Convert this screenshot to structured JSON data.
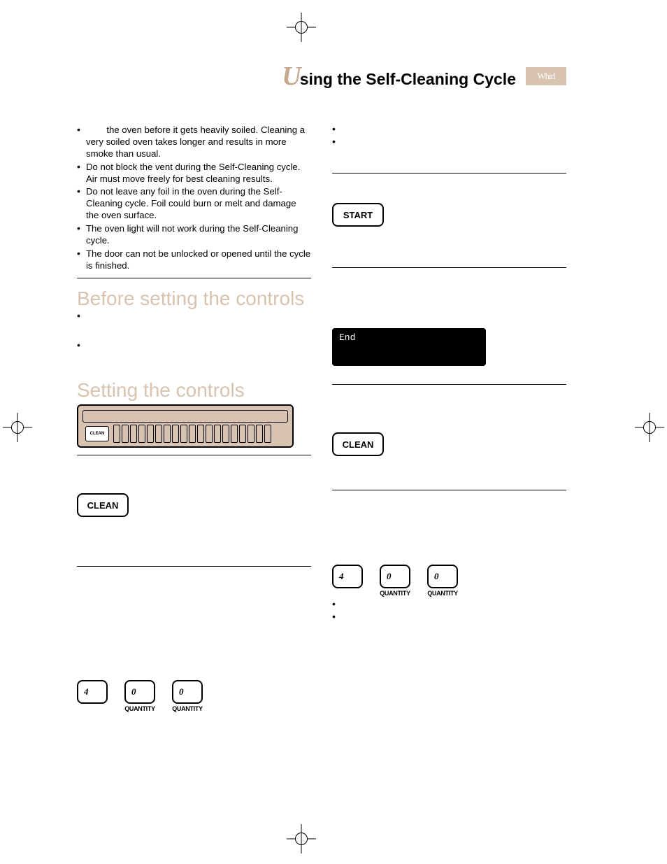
{
  "title": {
    "cap": "U",
    "rest": "sing the Self-Cleaning Cycle"
  },
  "brand_script": "Whirl",
  "left": {
    "tips": [
      "the oven before it gets heavily soiled. Cleaning a very soiled oven takes longer and results in more smoke than usual.",
      "Do not block the vent during the Self-Cleaning cycle. Air must move freely for best cleaning results.",
      "Do not leave any foil in the oven during the Self-Cleaning cycle. Foil could burn or melt and damage the oven surface.",
      "The oven light will not work during the Self-Cleaning cycle.",
      "The door can not be unlocked or opened until the cycle is finished."
    ],
    "section_before": "Before setting the controls",
    "section_setting": "Setting the controls",
    "panel_button": "CLEAN",
    "btn_clean": "CLEAN",
    "numbers": {
      "n1": "4",
      "n2": "0",
      "n3": "0",
      "qty": "QUANTITY"
    }
  },
  "right": {
    "btn_start": "START",
    "display_text": "End",
    "btn_clean": "CLEAN",
    "numbers": {
      "n1": "4",
      "n2": "0",
      "n3": "0",
      "qty": "QUANTITY"
    }
  }
}
